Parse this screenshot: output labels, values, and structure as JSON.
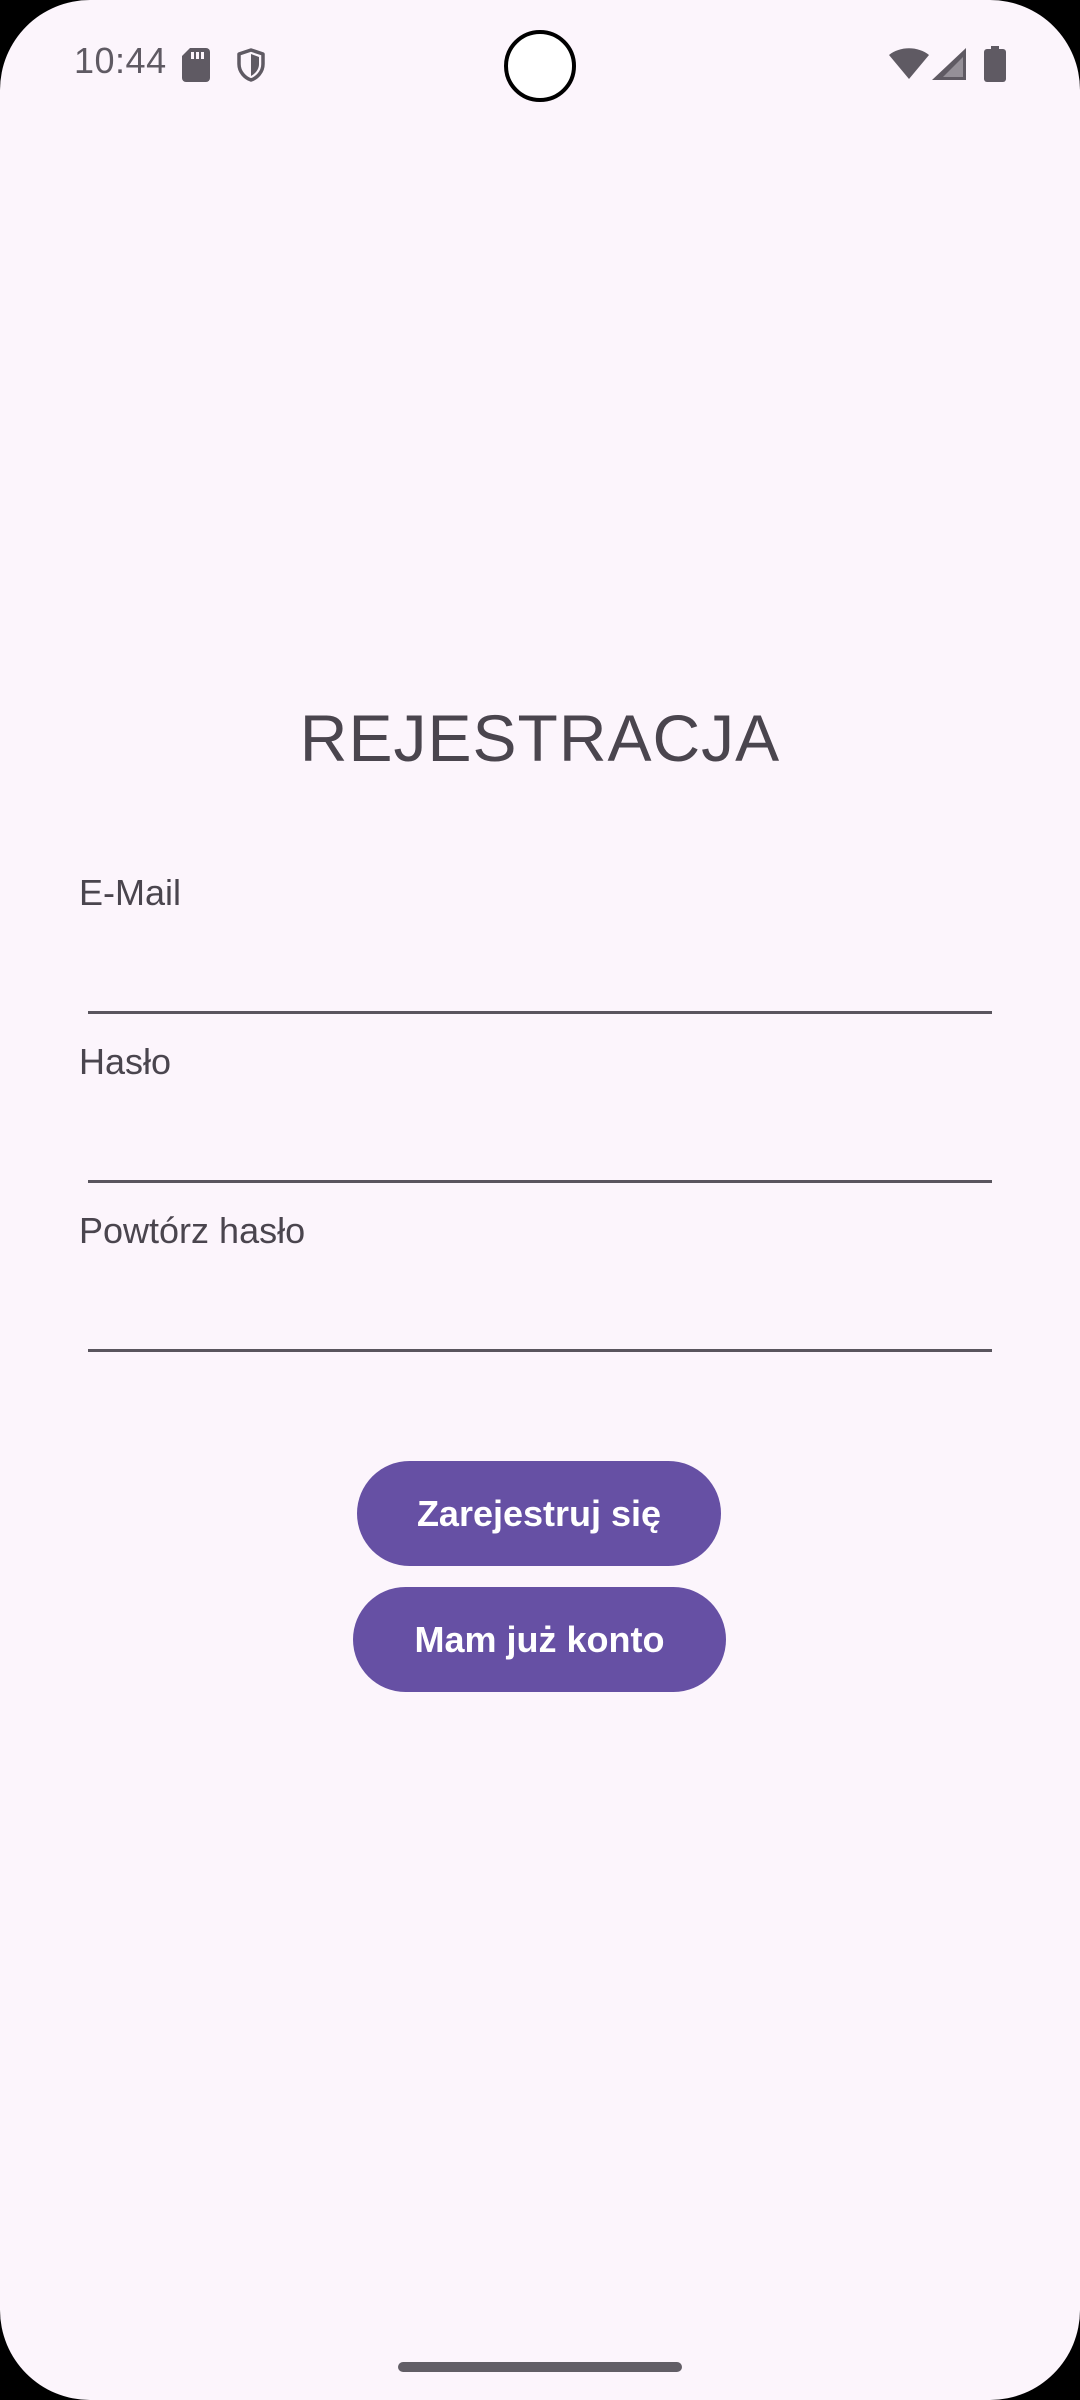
{
  "status_bar": {
    "time": "10:44",
    "icons": [
      "sd-card-icon",
      "shield-icon",
      "wifi-icon",
      "cellular-signal-icon",
      "battery-icon"
    ]
  },
  "screen": {
    "title": "REJESTRACJA",
    "fields": [
      {
        "label": "E-Mail",
        "value": "",
        "placeholder": ""
      },
      {
        "label": "Hasło",
        "value": "",
        "placeholder": ""
      },
      {
        "label": "Powtórz hasło",
        "value": "",
        "placeholder": ""
      }
    ],
    "buttons": {
      "register": "Zarejestruj się",
      "have_account": "Mam już konto"
    }
  },
  "colors": {
    "background": "#FCF5FC",
    "primary": "#6650A4",
    "on_primary": "#FFFFFF",
    "text": "#4A454E"
  }
}
